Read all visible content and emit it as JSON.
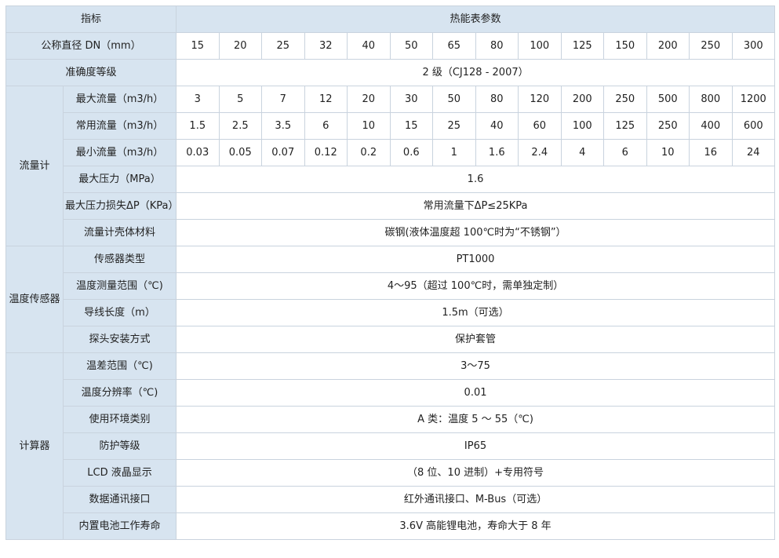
{
  "table": {
    "header": {
      "label": "指标",
      "title": "热能表参数"
    },
    "dn": {
      "label": "公称直径 DN（mm）",
      "values": [
        "15",
        "20",
        "25",
        "32",
        "40",
        "50",
        "65",
        "80",
        "100",
        "125",
        "150",
        "200",
        "250",
        "300"
      ]
    },
    "accuracy": {
      "label": "准确度等级",
      "value": "2 级（CJ128 - 2007）"
    },
    "flowmeter": {
      "category": "流量计",
      "max_flow": {
        "label": "最大流量（m3/h）",
        "values": [
          "3",
          "5",
          "7",
          "12",
          "20",
          "30",
          "50",
          "80",
          "120",
          "200",
          "250",
          "500",
          "800",
          "1200"
        ]
      },
      "common_flow": {
        "label": "常用流量（m3/h）",
        "values": [
          "1.5",
          "2.5",
          "3.5",
          "6",
          "10",
          "15",
          "25",
          "40",
          "60",
          "100",
          "125",
          "250",
          "400",
          "600"
        ]
      },
      "min_flow": {
        "label": "最小流量（m3/h）",
        "values": [
          "0.03",
          "0.05",
          "0.07",
          "0.12",
          "0.2",
          "0.6",
          "1",
          "1.6",
          "2.4",
          "4",
          "6",
          "10",
          "16",
          "24"
        ]
      },
      "max_pressure": {
        "label": "最大压力（MPa）",
        "value": "1.6"
      },
      "max_pressure_loss": {
        "label": "最大压力损失ΔP（KPa）",
        "value": "常用流量下ΔP≤25KPa"
      },
      "shell_material": {
        "label": "流量计壳体材料",
        "value": "碳钢(液体温度超 100℃时为“不锈钢”）"
      }
    },
    "temp_sensor": {
      "category": "温度传感器",
      "sensor_type": {
        "label": "传感器类型",
        "value": "PT1000"
      },
      "measure_range": {
        "label": "温度测量范围（℃)",
        "value": "4～95（超过 100℃时，需单独定制）"
      },
      "wire_length": {
        "label": "导线长度（m）",
        "value": "1.5m（可选）"
      },
      "probe_install": {
        "label": "探头安装方式",
        "value": "保护套管"
      }
    },
    "calculator": {
      "category": "计算器",
      "temp_diff_range": {
        "label": "温差范围（℃)",
        "value": "3～75"
      },
      "temp_resolution": {
        "label": "温度分辨率（℃)",
        "value": "0.01"
      },
      "env_class": {
        "label": "使用环境类别",
        "value": "A 类：温度 5 ～ 55（℃)"
      },
      "protection": {
        "label": "防护等级",
        "value": "IP65"
      },
      "lcd": {
        "label": "LCD 液晶显示",
        "value": "（8 位、10 进制）+专用符号"
      },
      "comm": {
        "label": "数据通讯接口",
        "value": "红外通讯接口、M-Bus（可选）"
      },
      "battery": {
        "label": "内置电池工作寿命",
        "value": "3.6V 高能锂电池，寿命大于 8 年"
      }
    }
  }
}
